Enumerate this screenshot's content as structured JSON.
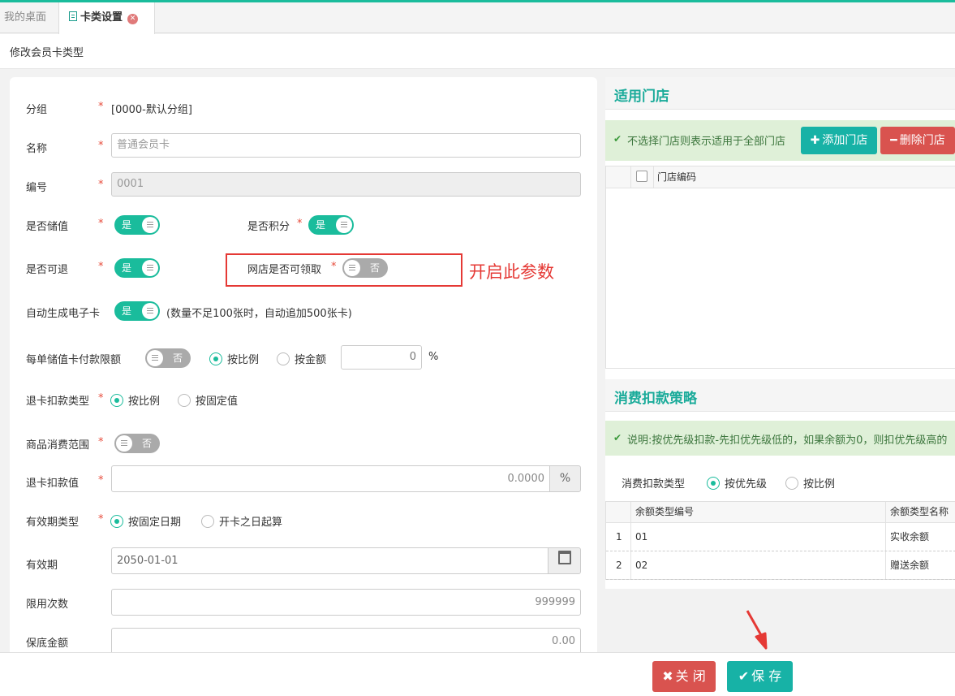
{
  "tabs": {
    "home": "我的桌面",
    "active": "卡类设置",
    "close_glyph": "✕"
  },
  "page_title": "修改会员卡类型",
  "form": {
    "group": {
      "label": "分组",
      "value": "[0000-默认分组]"
    },
    "name": {
      "label": "名称",
      "placeholder": "普通会员卡"
    },
    "code": {
      "label": "编号",
      "value": "0001"
    },
    "stored_value": {
      "label": "是否储值",
      "state": "是"
    },
    "points": {
      "label": "是否积分",
      "state": "是"
    },
    "refundable": {
      "label": "是否可退",
      "state": "是"
    },
    "online_claim": {
      "label": "网店是否可领取",
      "state": "否"
    },
    "auto_ecard": {
      "label": "自动生成电子卡",
      "state": "是",
      "note": "(数量不足100张时，自动追加500张卡)"
    },
    "pay_limit": {
      "label": "每单储值卡付款限额",
      "state": "否",
      "opt_ratio": "按比例",
      "opt_amount": "按金额",
      "amount": "0",
      "unit": "%"
    },
    "refund_type": {
      "label": "退卡扣款类型",
      "opt_ratio": "按比例",
      "opt_fixed": "按固定值"
    },
    "goods_scope": {
      "label": "商品消费范围",
      "state": "否"
    },
    "refund_value": {
      "label": "退卡扣款值",
      "value": "0.0000",
      "unit": "%"
    },
    "validity_type": {
      "label": "有效期类型",
      "opt_fixed": "按固定日期",
      "opt_open": "开卡之日起算"
    },
    "validity": {
      "label": "有效期",
      "value": "2050-01-01"
    },
    "limit_times": {
      "label": "限用次数",
      "value": "999999"
    },
    "min_amount": {
      "label": "保底金额",
      "value": "0.00"
    },
    "required_mark": "*"
  },
  "annotation": "开启此参数",
  "stores": {
    "title": "适用门店",
    "info": "不选择门店则表示适用于全部门店",
    "add_button": "添加门店",
    "delete_button": "删除门店",
    "col_code": "门店编码"
  },
  "deduction": {
    "title": "消费扣款策略",
    "info": "说明:按优先级扣款-先扣优先级低的，如果余额为0，则扣优先级高的",
    "type_label": "消费扣款类型",
    "opt_priority": "按优先级",
    "opt_ratio": "按比例",
    "col_code": "余额类型编号",
    "col_name": "余额类型名称",
    "rows": [
      {
        "idx": "1",
        "code": "01",
        "name": "实收余额"
      },
      {
        "idx": "2",
        "code": "02",
        "name": "赠送余额"
      }
    ]
  },
  "footer": {
    "close_button": "关 闭",
    "save_button": "保 存"
  },
  "colors": {
    "accent": "#1abc9c",
    "danger": "#d9534f",
    "annotation": "#e53935"
  }
}
